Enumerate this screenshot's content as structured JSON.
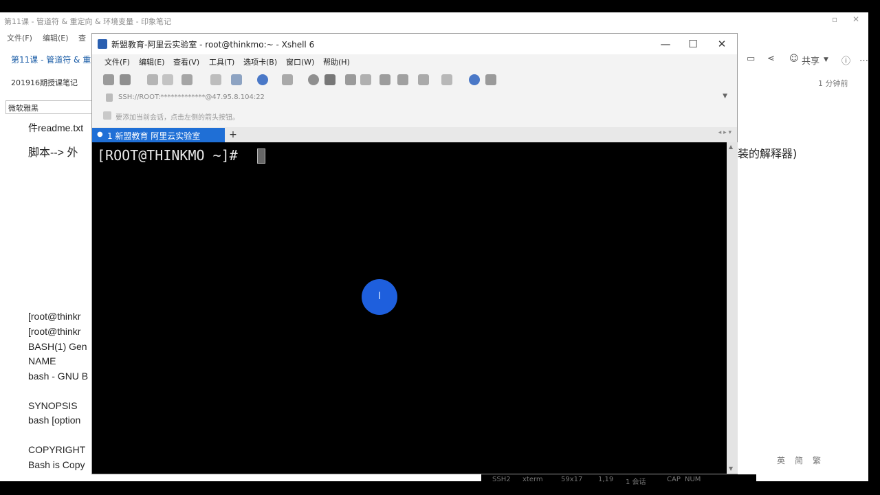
{
  "note_app": {
    "title": "第11课 - 管道符 & 重定向 & 环境变量 - 印象笔记",
    "menu": [
      "文件(F)",
      "编辑(E)",
      "查"
    ],
    "note_tab": "第11课 - 管道符 & 重",
    "notebook": "201916期授课笔记",
    "font": "微软雅黑",
    "updated": "1 分钟前",
    "share_label": "共享",
    "lines": {
      "readme": "件readme.txt",
      "script": "脚本--> 外",
      "script_tail": "安装的解释器)",
      "root1": "[root@thinkr",
      "root2": "[root@thinkr",
      "bash_gen": "BASH(1) Gen",
      "name": "NAME",
      "bash_gnu": "bash - GNU B",
      "synopsis": "SYNOPSIS",
      "bash_options": "bash [option",
      "copyright": "COPYRIGHT",
      "bash_copy": "Bash is Copy"
    }
  },
  "xshell": {
    "title": "新盟教育-阿里云实验室 - root@thinkmo:~ - Xshell 6",
    "menu": [
      "文件(F)",
      "编辑(E)",
      "查看(V)",
      "工具(T)",
      "选项卡(B)",
      "窗口(W)",
      "帮助(H)"
    ],
    "address": "SSH://ROOT:*************@47.95.8.104:22",
    "hint": "要添加当前会话，点击左侧的箭头按钮。",
    "tab_label": "1 新盟教育 阿里云实验室",
    "add_tab": "+",
    "prompt": "[ROOT@THINKMO ~]# ",
    "status": [
      "SSH2",
      "xterm",
      "59x17",
      "1,19",
      "1 会话",
      "CAP",
      "NUM"
    ]
  },
  "ime": [
    "英",
    "简",
    "繁"
  ],
  "colors": {
    "tab_active": "#1f6fd6",
    "click_dot": "#1e5fdd",
    "terminal_bg": "#000000"
  }
}
